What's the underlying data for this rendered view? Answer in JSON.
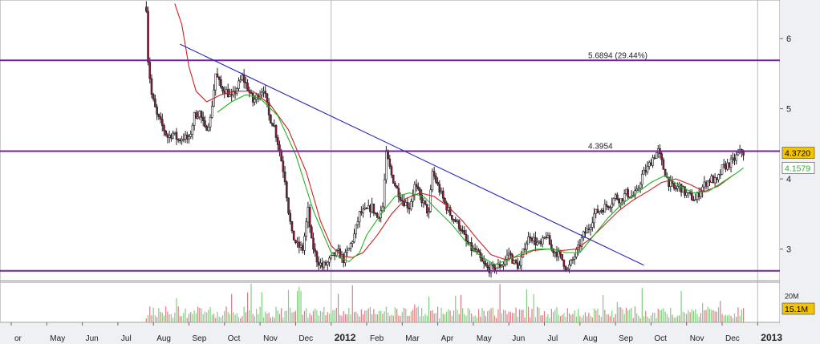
{
  "chart_data": {
    "type": "line",
    "subtype": "candlestick",
    "price_axis": {
      "ticks": [
        {
          "value": 3,
          "label": "3"
        },
        {
          "value": 4,
          "label": "4"
        },
        {
          "value": 5,
          "label": "5"
        },
        {
          "value": 6,
          "label": "6"
        }
      ],
      "ylim": [
        2.55,
        6.55
      ],
      "side": "right"
    },
    "volume_axis": {
      "tick_label": "20M",
      "ylim": [
        0,
        30
      ]
    },
    "x_axis": {
      "ticks": [
        {
          "label": "or",
          "month": 0,
          "bold": false
        },
        {
          "label": "May",
          "month": 1,
          "bold": false
        },
        {
          "label": "Jun",
          "month": 2,
          "bold": false
        },
        {
          "label": "Jul",
          "month": 3,
          "bold": false
        },
        {
          "label": "Aug",
          "month": 4,
          "bold": false
        },
        {
          "label": "Sep",
          "month": 5,
          "bold": false
        },
        {
          "label": "Oct",
          "month": 6,
          "bold": false
        },
        {
          "label": "Nov",
          "month": 7,
          "bold": false
        },
        {
          "label": "Dec",
          "month": 8,
          "bold": false
        },
        {
          "label": "2012",
          "month": 9,
          "bold": true
        },
        {
          "label": "Feb",
          "month": 10,
          "bold": false
        },
        {
          "label": "Mar",
          "month": 11,
          "bold": false
        },
        {
          "label": "Apr",
          "month": 12,
          "bold": false
        },
        {
          "label": "May",
          "month": 13,
          "bold": false
        },
        {
          "label": "Jun",
          "month": 14,
          "bold": false
        },
        {
          "label": "Jul",
          "month": 15,
          "bold": false
        },
        {
          "label": "Aug",
          "month": 16,
          "bold": false
        },
        {
          "label": "Sep",
          "month": 17,
          "bold": false
        },
        {
          "label": "Oct",
          "month": 18,
          "bold": false
        },
        {
          "label": "Nov",
          "month": 19,
          "bold": false
        },
        {
          "label": "Dec",
          "month": 20,
          "bold": false
        },
        {
          "label": "2013",
          "month": 21,
          "bold": true
        }
      ],
      "range_months": [
        -0.8,
        21.0
      ],
      "year_separators": [
        9,
        21
      ]
    },
    "horizontal_lines": [
      {
        "value": 5.6894,
        "label": "5.6894 (29.44%)",
        "color": "#7a1fa2"
      },
      {
        "value": 4.3954,
        "label": "4.3954",
        "color": "#7a1fa2"
      },
      {
        "value": 2.69,
        "label": "",
        "color": "#7a1fa2"
      }
    ],
    "trendline": {
      "x1": 4.75,
      "y1": 5.92,
      "x2": 17.8,
      "y2": 2.77,
      "color": "#2424b8"
    },
    "price_series": {
      "name": "",
      "color": "#111111",
      "points": [
        [
          3.8,
          6.45
        ],
        [
          3.85,
          5.7
        ],
        [
          3.95,
          5.2
        ],
        [
          4.1,
          4.9
        ],
        [
          4.25,
          4.75
        ],
        [
          4.4,
          4.6
        ],
        [
          4.55,
          4.65
        ],
        [
          4.7,
          4.55
        ],
        [
          4.85,
          4.6
        ],
        [
          5.0,
          4.55
        ],
        [
          5.15,
          4.9
        ],
        [
          5.3,
          4.95
        ],
        [
          5.45,
          4.7
        ],
        [
          5.6,
          4.85
        ],
        [
          5.75,
          5.5
        ],
        [
          5.9,
          5.3
        ],
        [
          6.05,
          5.25
        ],
        [
          6.2,
          5.15
        ],
        [
          6.35,
          5.3
        ],
        [
          6.5,
          5.45
        ],
        [
          6.65,
          5.3
        ],
        [
          6.8,
          5.1
        ],
        [
          6.95,
          5.2
        ],
        [
          7.1,
          5.3
        ],
        [
          7.25,
          4.9
        ],
        [
          7.4,
          4.75
        ],
        [
          7.55,
          4.4
        ],
        [
          7.7,
          4.0
        ],
        [
          7.8,
          3.55
        ],
        [
          7.9,
          3.2
        ],
        [
          8.05,
          3.05
        ],
        [
          8.2,
          3.0
        ],
        [
          8.35,
          3.55
        ],
        [
          8.45,
          3.1
        ],
        [
          8.6,
          2.85
        ],
        [
          8.75,
          2.75
        ],
        [
          8.9,
          2.8
        ],
        [
          9.05,
          2.9
        ],
        [
          9.2,
          2.95
        ],
        [
          9.35,
          2.85
        ],
        [
          9.5,
          3.0
        ],
        [
          9.65,
          3.2
        ],
        [
          9.8,
          3.5
        ],
        [
          10.0,
          3.55
        ],
        [
          10.15,
          3.6
        ],
        [
          10.3,
          3.45
        ],
        [
          10.45,
          3.6
        ],
        [
          10.55,
          4.35
        ],
        [
          10.7,
          4.05
        ],
        [
          10.85,
          3.85
        ],
        [
          11.0,
          3.7
        ],
        [
          11.2,
          3.6
        ],
        [
          11.35,
          3.9
        ],
        [
          11.5,
          3.75
        ],
        [
          11.65,
          3.6
        ],
        [
          11.75,
          3.5
        ],
        [
          11.85,
          4.1
        ],
        [
          12.0,
          3.9
        ],
        [
          12.2,
          3.65
        ],
        [
          12.35,
          3.5
        ],
        [
          12.5,
          3.4
        ],
        [
          12.65,
          3.3
        ],
        [
          12.8,
          3.1
        ],
        [
          12.95,
          3.0
        ],
        [
          13.1,
          2.95
        ],
        [
          13.25,
          2.8
        ],
        [
          13.4,
          2.72
        ],
        [
          13.55,
          2.72
        ],
        [
          13.7,
          2.75
        ],
        [
          13.85,
          2.8
        ],
        [
          14.0,
          2.95
        ],
        [
          14.15,
          2.8
        ],
        [
          14.3,
          2.75
        ],
        [
          14.45,
          3.05
        ],
        [
          14.6,
          3.2
        ],
        [
          14.75,
          3.1
        ],
        [
          14.9,
          3.05
        ],
        [
          15.05,
          3.2
        ],
        [
          15.2,
          3.0
        ],
        [
          15.35,
          2.95
        ],
        [
          15.5,
          2.85
        ],
        [
          15.65,
          2.7
        ],
        [
          15.8,
          2.85
        ],
        [
          15.95,
          3.0
        ],
        [
          16.1,
          3.2
        ],
        [
          16.25,
          3.3
        ],
        [
          16.4,
          3.5
        ],
        [
          16.55,
          3.55
        ],
        [
          16.7,
          3.6
        ],
        [
          16.85,
          3.65
        ],
        [
          17.0,
          3.75
        ],
        [
          17.15,
          3.7
        ],
        [
          17.3,
          3.8
        ],
        [
          17.45,
          3.75
        ],
        [
          17.6,
          3.8
        ],
        [
          17.75,
          4.05
        ],
        [
          17.9,
          4.15
        ],
        [
          18.05,
          4.3
        ],
        [
          18.2,
          4.4
        ],
        [
          18.35,
          4.15
        ],
        [
          18.5,
          3.95
        ],
        [
          18.65,
          3.85
        ],
        [
          18.8,
          3.9
        ],
        [
          18.95,
          3.8
        ],
        [
          19.1,
          3.75
        ],
        [
          19.25,
          3.7
        ],
        [
          19.4,
          3.85
        ],
        [
          19.55,
          3.95
        ],
        [
          19.7,
          4.0
        ],
        [
          19.85,
          3.95
        ],
        [
          20.0,
          4.15
        ],
        [
          20.15,
          4.2
        ],
        [
          20.3,
          4.25
        ],
        [
          20.45,
          4.35
        ],
        [
          20.55,
          4.4
        ],
        [
          20.6,
          4.372
        ]
      ]
    },
    "ma_short": {
      "name": "",
      "color": "#22b522",
      "points": [
        [
          5.8,
          4.95
        ],
        [
          6.2,
          5.1
        ],
        [
          6.6,
          5.2
        ],
        [
          7.0,
          5.15
        ],
        [
          7.5,
          4.9
        ],
        [
          8.0,
          4.35
        ],
        [
          8.5,
          3.55
        ],
        [
          9.0,
          2.95
        ],
        [
          9.5,
          2.82
        ],
        [
          9.8,
          2.95
        ],
        [
          10.0,
          3.2
        ],
        [
          10.4,
          3.5
        ],
        [
          10.8,
          3.75
        ],
        [
          11.2,
          3.8
        ],
        [
          11.6,
          3.75
        ],
        [
          12.0,
          3.55
        ],
        [
          12.4,
          3.35
        ],
        [
          12.8,
          3.1
        ],
        [
          13.2,
          2.9
        ],
        [
          13.6,
          2.78
        ],
        [
          14.0,
          2.85
        ],
        [
          14.4,
          2.95
        ],
        [
          14.8,
          3.0
        ],
        [
          15.2,
          3.0
        ],
        [
          15.6,
          2.95
        ],
        [
          16.0,
          2.95
        ],
        [
          16.4,
          3.2
        ],
        [
          16.8,
          3.45
        ],
        [
          17.2,
          3.65
        ],
        [
          17.6,
          3.8
        ],
        [
          18.0,
          3.95
        ],
        [
          18.4,
          4.05
        ],
        [
          18.8,
          3.9
        ],
        [
          19.2,
          3.8
        ],
        [
          19.6,
          3.82
        ],
        [
          20.0,
          3.95
        ],
        [
          20.4,
          4.08
        ],
        [
          20.6,
          4.158
        ]
      ]
    },
    "ma_long": {
      "name": "",
      "color": "#cc2222",
      "points": [
        [
          4.6,
          6.5
        ],
        [
          4.8,
          6.2
        ],
        [
          5.0,
          5.6
        ],
        [
          5.2,
          5.25
        ],
        [
          5.5,
          5.1
        ],
        [
          5.9,
          5.2
        ],
        [
          6.3,
          5.25
        ],
        [
          6.8,
          5.25
        ],
        [
          7.3,
          5.05
        ],
        [
          7.8,
          4.7
        ],
        [
          8.3,
          4.1
        ],
        [
          8.7,
          3.4
        ],
        [
          9.0,
          3.05
        ],
        [
          9.3,
          2.9
        ],
        [
          9.6,
          2.88
        ],
        [
          9.9,
          2.95
        ],
        [
          10.3,
          3.2
        ],
        [
          10.7,
          3.5
        ],
        [
          11.1,
          3.72
        ],
        [
          11.5,
          3.8
        ],
        [
          11.9,
          3.75
        ],
        [
          12.3,
          3.6
        ],
        [
          12.7,
          3.4
        ],
        [
          13.1,
          3.15
        ],
        [
          13.5,
          2.92
        ],
        [
          13.9,
          2.85
        ],
        [
          14.3,
          2.9
        ],
        [
          14.7,
          2.98
        ],
        [
          15.1,
          3.0
        ],
        [
          15.5,
          2.98
        ],
        [
          15.9,
          3.0
        ],
        [
          16.3,
          3.15
        ],
        [
          16.7,
          3.35
        ],
        [
          17.1,
          3.55
        ],
        [
          17.5,
          3.7
        ],
        [
          17.9,
          3.82
        ],
        [
          18.3,
          3.95
        ],
        [
          18.7,
          4.0
        ],
        [
          19.1,
          3.92
        ],
        [
          19.5,
          3.82
        ],
        [
          19.9,
          3.9
        ],
        [
          20.3,
          4.05
        ]
      ]
    },
    "last_price_label": {
      "value": 4.372,
      "label": "4.3720",
      "color": "#f5c400"
    },
    "ma_price_label": {
      "value": 4.1579,
      "label": "4.1579",
      "color": "#22b522"
    },
    "volume_label": {
      "label": "15.1M",
      "color": "#f5c400"
    }
  }
}
